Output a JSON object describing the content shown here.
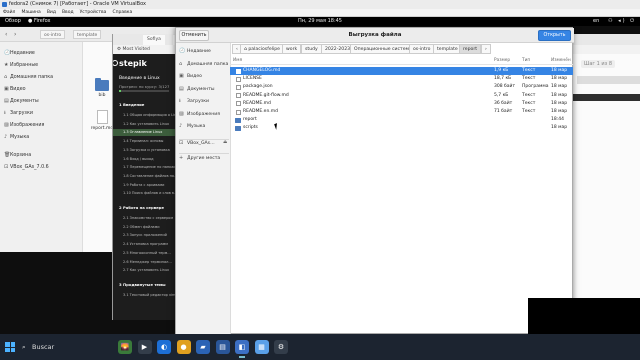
{
  "vbox": {
    "title": "fedora2 (Снимок 7) [Работает] - Oracle VM VirtualBox",
    "menu": [
      "Файл",
      "Машина",
      "Вид",
      "Ввод",
      "Устройства",
      "Справка"
    ]
  },
  "gnome": {
    "activities": "Обзор",
    "app": "Firefox",
    "clock": "Пн, 29 мая  18:45",
    "lang": "en",
    "tray": "⚇ ◂) ⏻"
  },
  "files": {
    "crumbs": [
      "os-intro",
      "template"
    ],
    "sidebar": [
      {
        "icon": "🕘",
        "label": "Недавние"
      },
      {
        "icon": "★",
        "label": "Избранные"
      },
      {
        "icon": "⌂",
        "label": "Домашняя папка"
      },
      {
        "icon": "▣",
        "label": "Видео"
      },
      {
        "icon": "▤",
        "label": "Документы"
      },
      {
        "icon": "⭳",
        "label": "Загрузки"
      },
      {
        "icon": "▨",
        "label": "Изображения"
      },
      {
        "icon": "♪",
        "label": "Музыка"
      },
      {
        "icon": "🗑",
        "label": "Корзина"
      },
      {
        "icon": "⊡",
        "label": "VBox_GAs_7.0.6"
      }
    ],
    "items": [
      "bib",
      "report.md"
    ]
  },
  "firefox": {
    "tabs": [
      "Sofiya",
      "О"
    ],
    "bookmarks": "Most Visited",
    "right_tag": "Шаг 1 из 8",
    "stepik": {
      "logo": "stepik",
      "course": "Введение в Linux",
      "progress": "Прогресс по курсу: 3/127",
      "progress_fraction": 0.03,
      "sections": [
        {
          "title": "1 Введение",
          "items": [
            {
              "label": "1.1 Общая информация о Linux",
              "active": false
            },
            {
              "label": "1.2 Как установить Linux",
              "active": false
            },
            {
              "label": "1.3 Оглавление Linux",
              "active": true
            },
            {
              "label": "1.4 Терминал: основы",
              "active": false
            },
            {
              "label": "1.5 Загрузка и установка",
              "active": false
            },
            {
              "label": "1.6 Вход / выход",
              "active": false
            },
            {
              "label": "1.7 Перемещение по папкам",
              "active": false
            },
            {
              "label": "1.8 Составление файлов на…",
              "active": false
            },
            {
              "label": "1.9 Работа с архивами",
              "active": false
            },
            {
              "label": "1.10 Поиск файлов и слов в…",
              "active": false
            }
          ]
        },
        {
          "title": "2 Работа на сервере",
          "items": [
            {
              "label": "2.1 Знакомство с сервером",
              "active": false
            },
            {
              "label": "2.2 Обмен файлами",
              "active": false
            },
            {
              "label": "2.3 Запуск приложений",
              "active": false
            },
            {
              "label": "2.4 Установка программ",
              "active": false
            },
            {
              "label": "2.5 Многооконный терм…",
              "active": false
            },
            {
              "label": "2.6 Менеджер терминал…",
              "active": false
            },
            {
              "label": "2.7 Как установить Linux",
              "active": false
            }
          ]
        },
        {
          "title": "3 Продвинутые темы",
          "items": [
            {
              "label": "3.1 Текстовый редактор vim",
              "active": false
            }
          ]
        }
      ]
    }
  },
  "dialog": {
    "title": "Выгрузка файла",
    "cancel": "Отменить",
    "open": "Открыть",
    "sidebar": [
      {
        "icon": "🕘",
        "label": "Недавние"
      },
      {
        "icon": "⌂",
        "label": "Домашняя папка"
      },
      {
        "icon": "▣",
        "label": "Видео"
      },
      {
        "icon": "▤",
        "label": "Документы"
      },
      {
        "icon": "⭳",
        "label": "Загрузки"
      },
      {
        "icon": "▨",
        "label": "Изображения"
      },
      {
        "icon": "♪",
        "label": "Музыка"
      },
      {
        "icon": "⊡",
        "label": "VBox_GAs…"
      },
      {
        "icon": "+",
        "label": "Другие места"
      }
    ],
    "path": [
      "palaciosfelipe",
      "work",
      "study",
      "2022-2023",
      "Операционные системы",
      "os-intro",
      "template",
      "report"
    ],
    "columns": {
      "name": "Имя",
      "size": "Размер",
      "type": "Тип",
      "modified": "Изменён"
    },
    "rows": [
      {
        "name": "CHANGELOG.md",
        "size": "1,9 кБ",
        "type": "Текст",
        "modified": "18 мар",
        "kind": "file",
        "selected": true
      },
      {
        "name": "LICENSE",
        "size": "18,7 кБ",
        "type": "Текст",
        "modified": "18 мар",
        "kind": "file",
        "selected": false
      },
      {
        "name": "package.json",
        "size": "308 байт",
        "type": "Программа",
        "modified": "18 мар",
        "kind": "file",
        "selected": false
      },
      {
        "name": "README.git-flow.md",
        "size": "5,7 кБ",
        "type": "Текст",
        "modified": "18 мар",
        "kind": "file",
        "selected": false
      },
      {
        "name": "README.md",
        "size": "36 байт",
        "type": "Текст",
        "modified": "18 мар",
        "kind": "file",
        "selected": false
      },
      {
        "name": "README.en.md",
        "size": "71 байт",
        "type": "Текст",
        "modified": "18 мар",
        "kind": "file",
        "selected": false
      },
      {
        "name": "report",
        "size": "",
        "type": "",
        "modified": "18:44",
        "kind": "folder",
        "selected": false
      },
      {
        "name": "scripts",
        "size": "",
        "type": "",
        "modified": "18 мар",
        "kind": "folder",
        "selected": false
      }
    ]
  },
  "taskbar": {
    "search": "Buscar",
    "apps": [
      {
        "icon": "🌄",
        "color": "#3a7a3a"
      },
      {
        "icon": "▶",
        "color": "#333d4a"
      },
      {
        "icon": "◐",
        "color": "#1d6fd6"
      },
      {
        "icon": "●",
        "color": "#e0a020"
      },
      {
        "icon": "▰",
        "color": "#2b63b5"
      },
      {
        "icon": "▤",
        "color": "#2a5699"
      },
      {
        "icon": "◧",
        "color": "#3c6fc3"
      },
      {
        "icon": "▦",
        "color": "#5aa0e8"
      },
      {
        "icon": "⚙",
        "color": "#333d4a"
      }
    ]
  }
}
